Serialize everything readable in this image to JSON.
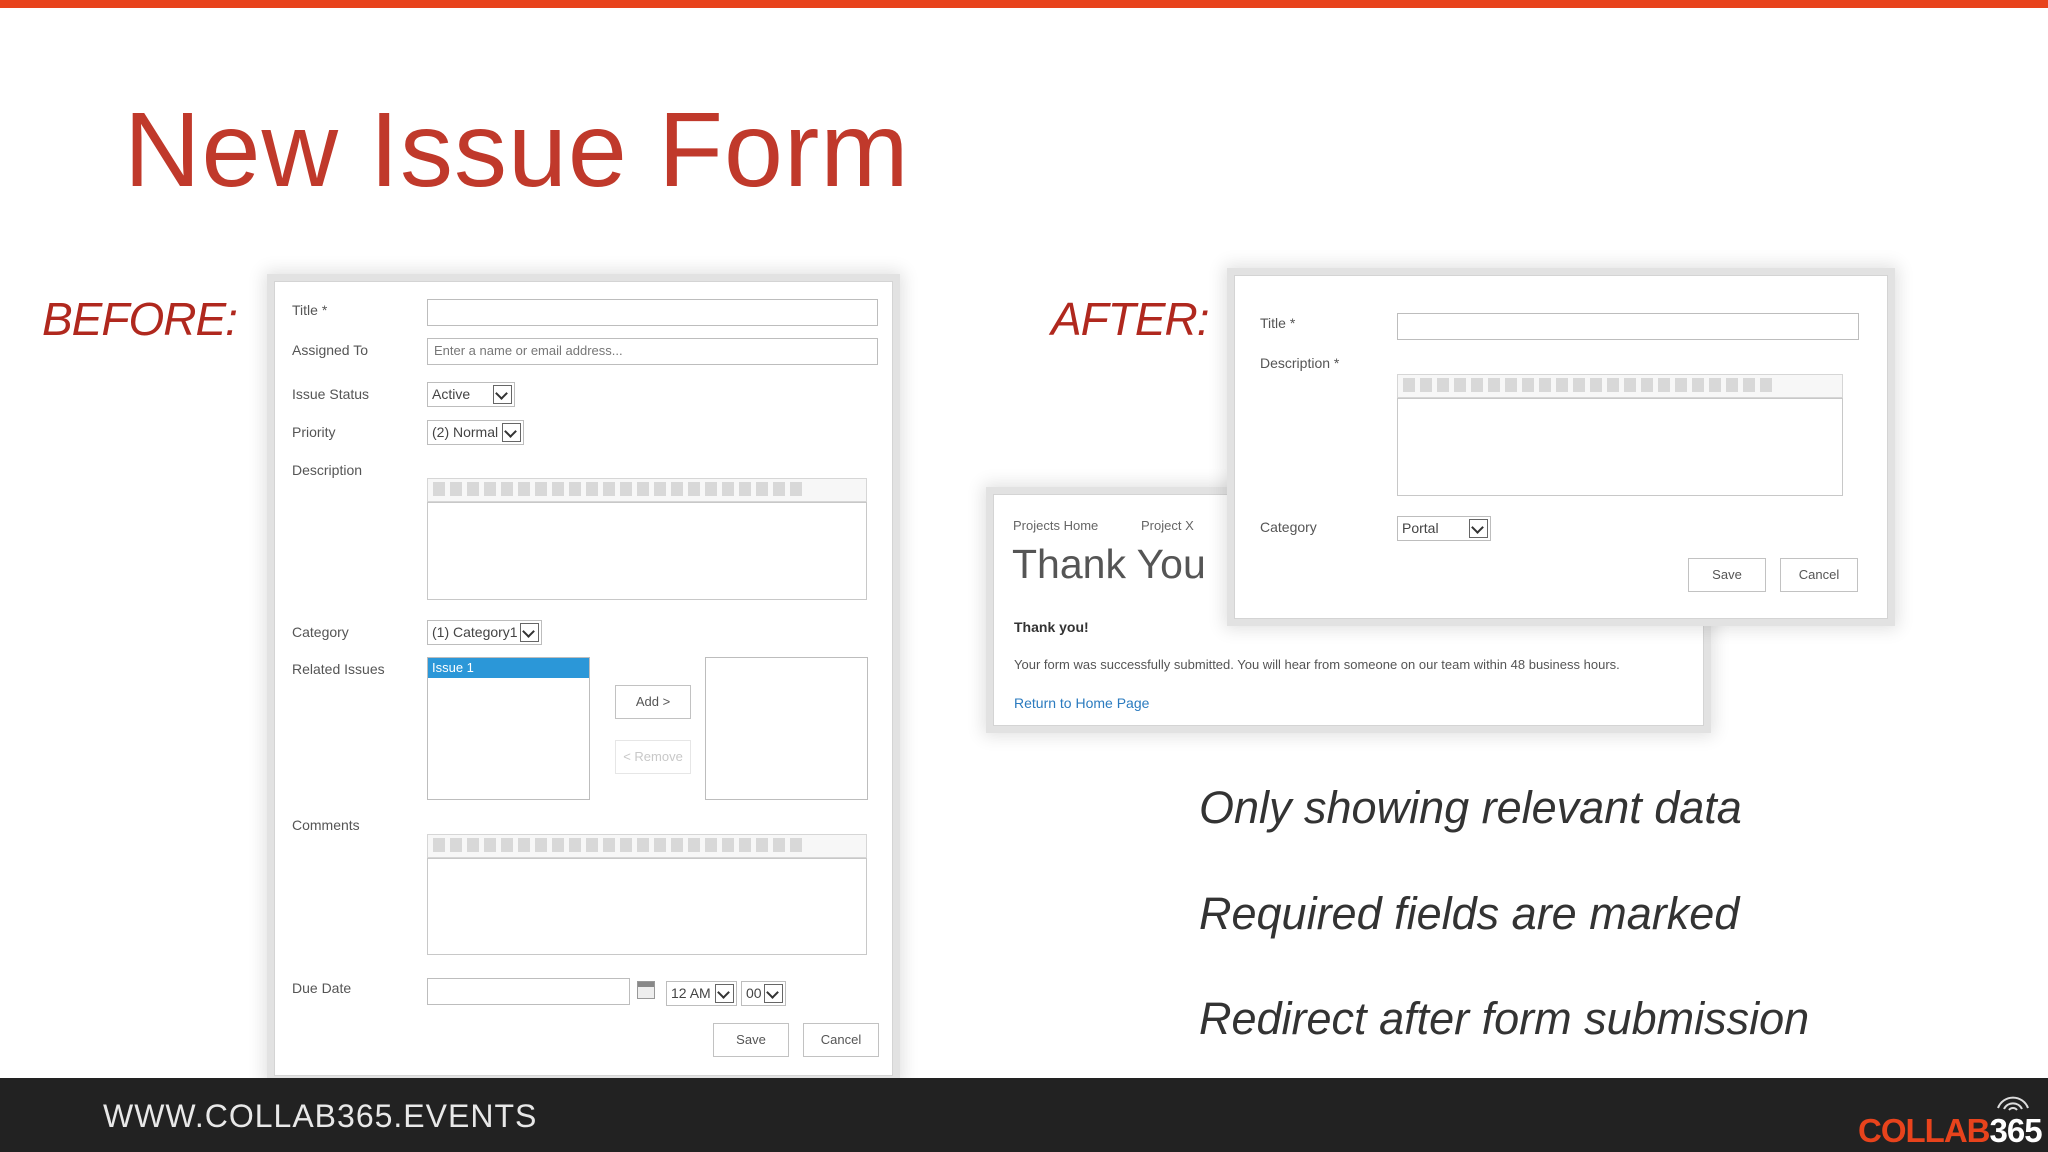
{
  "slide": {
    "title": "New Issue Form",
    "before_label": "BEFORE:",
    "after_label": "AFTER:"
  },
  "before_form": {
    "title_label": "Title *",
    "assigned_to_label": "Assigned To",
    "assigned_to_placeholder": "Enter a name or email address...",
    "issue_status_label": "Issue Status",
    "issue_status_value": "Active",
    "priority_label": "Priority",
    "priority_value": "(2) Normal",
    "description_label": "Description",
    "category_label": "Category",
    "category_value": "(1) Category1",
    "related_issues_label": "Related Issues",
    "related_issue_item": "Issue 1",
    "add_label": "Add >",
    "remove_label": "< Remove",
    "comments_label": "Comments",
    "due_date_label": "Due Date",
    "hour_value": "12 AM",
    "minute_value": "00",
    "save_label": "Save",
    "cancel_label": "Cancel"
  },
  "after_form": {
    "title_label": "Title *",
    "description_label": "Description *",
    "category_label": "Category",
    "category_value": "Portal",
    "save_label": "Save",
    "cancel_label": "Cancel"
  },
  "thank_you_page": {
    "breadcrumb_home": "Projects Home",
    "breadcrumb_project": "Project X",
    "heading": "Thank You",
    "bold_text": "Thank you!",
    "message": "Your form was successfully submitted. You will hear from someone on our team within 48 business hours.",
    "return_link": "Return to Home Page"
  },
  "bullets": [
    "Only showing relevant data",
    "Required fields are marked",
    "Redirect after form submission"
  ],
  "footer": {
    "url": "WWW.COLLAB365.EVENTS",
    "logo_text": "COLLAB",
    "logo_number": "365"
  },
  "colors": {
    "accent": "#e8431c",
    "title": "#c0392b",
    "label": "#b0281e",
    "footer": "#222222",
    "selection": "#2b97d8"
  }
}
